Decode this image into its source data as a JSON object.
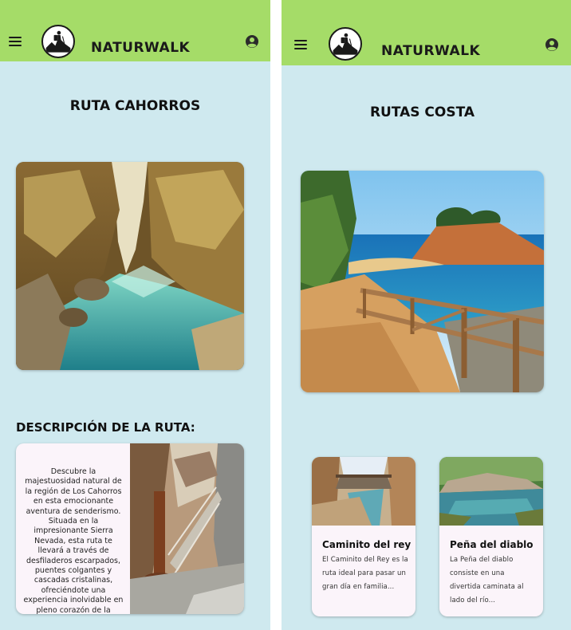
{
  "app": {
    "brand": "NATURWALK"
  },
  "colors": {
    "topbar": "#a5dc68",
    "background": "#cfe9ef",
    "card": "#fbf4fa"
  },
  "screen_left": {
    "title": "RUTA CAHORROS",
    "section_title": "DESCRIPCIÓN DE LA RUTA:",
    "description": "Descubre la majestuosidad natural de la región de Los Cahorros en esta emocionante aventura de senderismo. Situada en la impresionante Sierra Nevada, esta ruta te llevará a través de desfiladeros escarpados, puentes colgantes y cascadas cristalinas, ofreciéndote una experiencia inolvidable en pleno corazón de la naturaleza.",
    "hero_image": "canyon-river-photo",
    "description_image": "hanging-bridge-photo"
  },
  "screen_right": {
    "title": "RUTAS COSTA",
    "hero_image": "coastal-path-photo",
    "routes": [
      {
        "name": "Caminito del rey",
        "description": "El Caminito del Rey es la ruta ideal para pasar un gran día en familia...",
        "image": "gorge-walkway-photo"
      },
      {
        "name": "Peña del diablo",
        "description": "La Peña del diablo consiste en una divertida caminata al lado del río...",
        "image": "river-pool-photo"
      }
    ]
  },
  "icons": {
    "menu": "menu-icon",
    "user": "account-circle-icon",
    "logo": "hiker-logo"
  }
}
